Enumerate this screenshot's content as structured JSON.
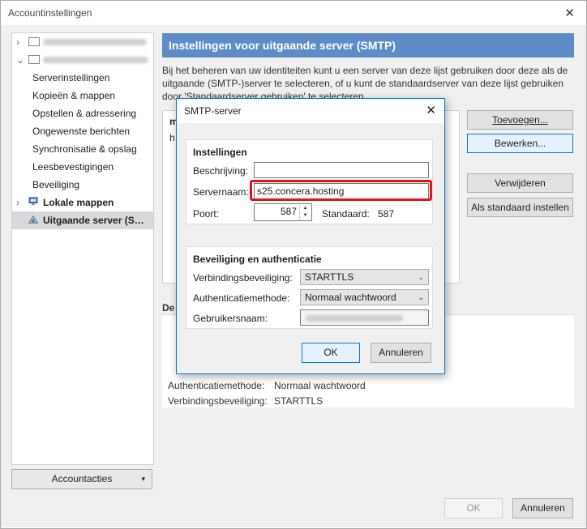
{
  "window": {
    "title": "Accountinstellingen",
    "close_glyph": "✕"
  },
  "sidebar": {
    "items": [
      {
        "label": "Serverinstellingen"
      },
      {
        "label": "Kopieën & mappen"
      },
      {
        "label": "Opstellen & adressering"
      },
      {
        "label": "Ongewenste berichten"
      },
      {
        "label": "Synchronisatie & opslag"
      },
      {
        "label": "Leesbevestigingen"
      },
      {
        "label": "Beveiliging"
      }
    ],
    "local_folders": "Lokale mappen",
    "outgoing": "Uitgaande server (SMTP)",
    "account_actions": "Accountacties"
  },
  "main": {
    "header": "Instellingen voor uitgaande server (SMTP)",
    "description": "Bij het beheren van uw identiteiten kunt u een server van deze lijst gebruiken door deze als de uitgaande (SMTP-)server te selecteren, of u kunt de standaardserver van deze lijst gebruiken door 'Standaardserver gebruiken' te selecteren.",
    "list_rows": [
      "m",
      "h"
    ],
    "buttons": {
      "add": "Toevoegen...",
      "edit": "Bewerken...",
      "remove": "Verwijderen",
      "set_default": "Als standaard instellen"
    },
    "details_label": "De",
    "details": [
      {
        "label": "Authenticatiemethode:",
        "value": "Normaal wachtwoord"
      },
      {
        "label": "Verbindingsbeveiliging:",
        "value": "STARTTLS"
      }
    ]
  },
  "dialog": {
    "title": "SMTP-server",
    "close_glyph": "✕",
    "settings_group": "Instellingen",
    "description_label": "Beschrijving:",
    "description_value": "",
    "servername_label": "Servernaam:",
    "servername_value": "s25.concera.hosting",
    "port_label": "Poort:",
    "port_value": "587",
    "default_label": "Standaard:",
    "default_value": "587",
    "security_group": "Beveiliging en authenticatie",
    "conn_security_label": "Verbindingsbeveiliging:",
    "conn_security_value": "STARTTLS",
    "auth_label": "Authenticatiemethode:",
    "auth_value": "Normaal wachtwoord",
    "username_label": "Gebruikersnaam:",
    "ok": "OK",
    "cancel": "Annuleren"
  },
  "footer": {
    "ok": "OK",
    "cancel": "Annuleren"
  },
  "colors": {
    "header": "#5d8cc6",
    "highlight": "#e0141e",
    "focus": "#0078d7"
  },
  "icons": [
    "mail-icon",
    "folder-icon",
    "outgoing-server-icon",
    "chevron-right-icon",
    "chevron-down-icon",
    "close-icon"
  ]
}
